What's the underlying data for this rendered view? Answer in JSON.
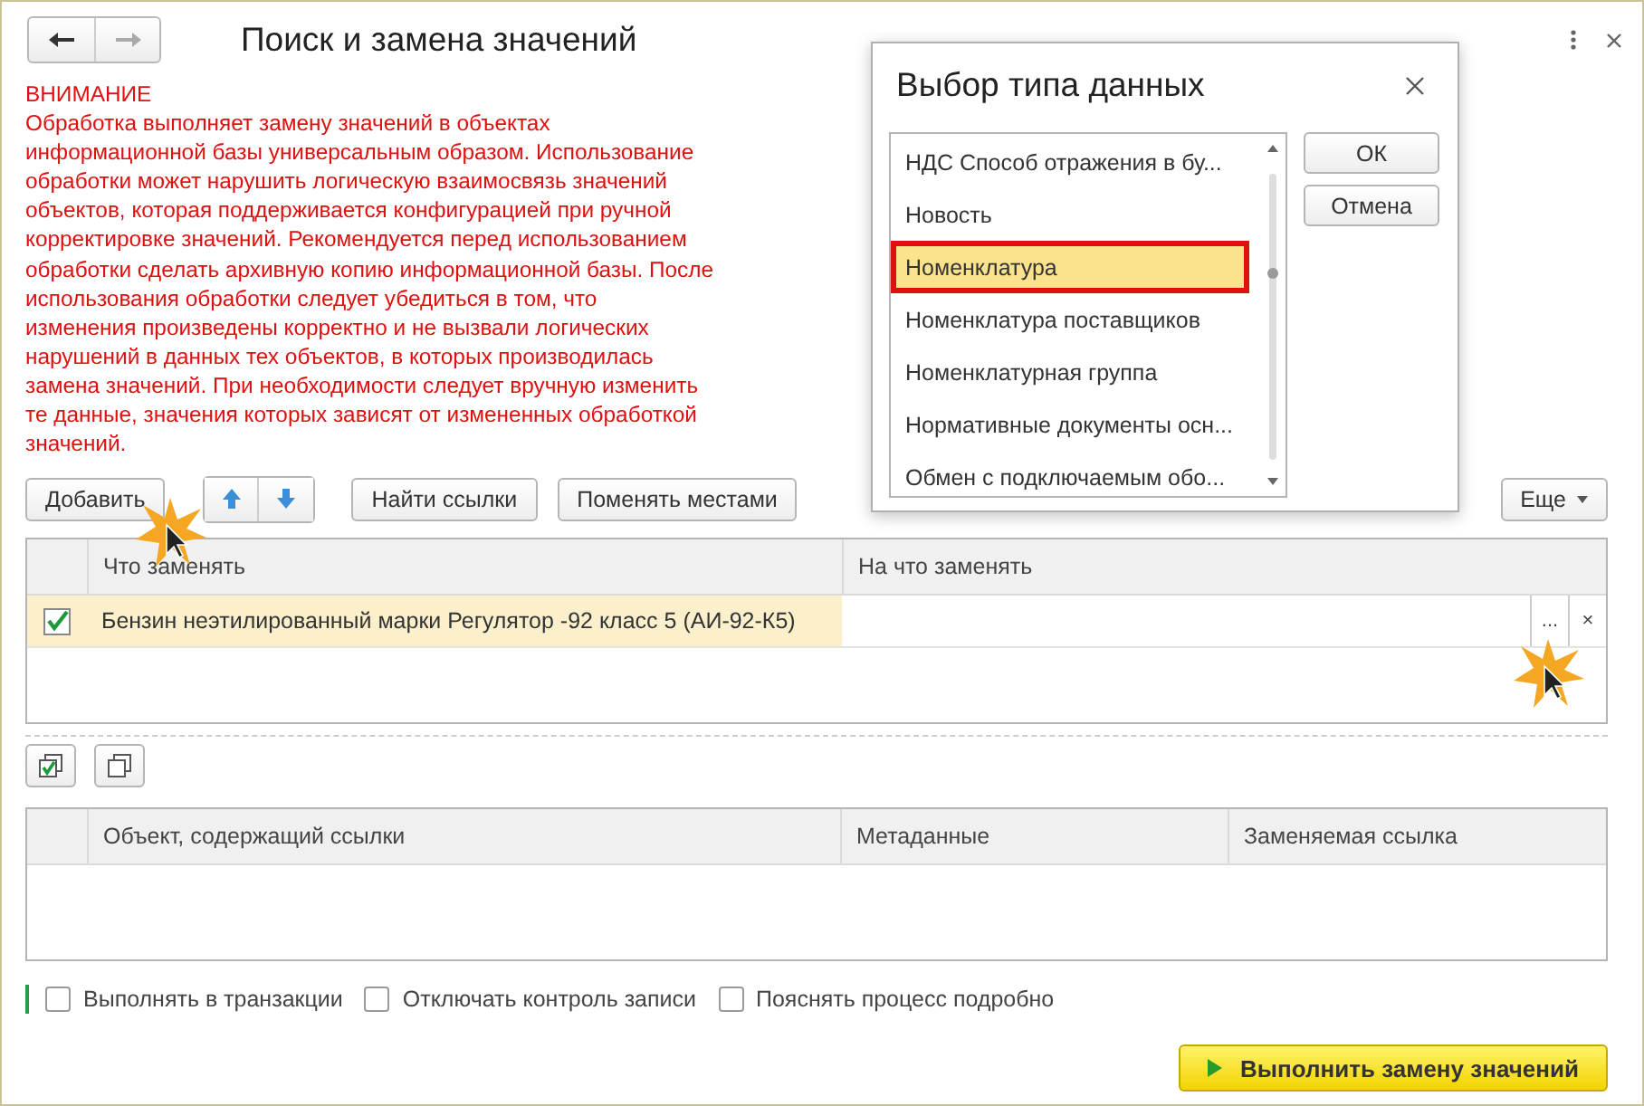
{
  "window": {
    "title": "Поиск и замена значений",
    "nav": [
      {
        "kind": "back",
        "disabled": false
      },
      {
        "kind": "forward",
        "disabled": true
      }
    ]
  },
  "warning": {
    "heading": "ВНИМАНИЕ",
    "body": "Обработка выполняет замену значений в объектах\nинформационной базы универсальным образом.  Использование\nобработки может нарушить логическую взаимосвязь значений\nобъектов, которая поддерживается конфигурацией при ручной\nкорректировке значений. Рекомендуется перед использованием\nобработки сделать архивную копию информационной базы. После\nиспользования обработки следует убедиться в том, что\nизменения произведены корректно и не вызвали логических\nнарушений в данных тех объектов, в которых производилась\nзамена значений. При необходимости следует вручную изменить\nте данные, значения которых зависят от измененных обработкой\nзначений."
  },
  "toolbar": {
    "add": "Добавить",
    "find": "Найти ссылки",
    "swap": "Поменять местами",
    "more": "Еще"
  },
  "replace_table": {
    "columns": [
      "Что заменять",
      "На что заменять"
    ],
    "rows": [
      {
        "checked": true,
        "what": "Бензин неэтилированный марки Регулятор -92 класс 5 (АИ-92-К5)",
        "selected": true,
        "choose": "...",
        "clear": "×"
      }
    ]
  },
  "refs_table": {
    "columns": [
      "Объект, содержащий ссылки",
      "Метаданные",
      "Заменяемая ссылка"
    ]
  },
  "options": [
    {
      "label": "Выполнять в транзакции",
      "checked": false
    },
    {
      "label": "Отключать контроль записи",
      "checked": false
    },
    {
      "label": "Пояснять процесс подробно",
      "checked": false
    }
  ],
  "run_button": "Выполнить замену значений",
  "dialog": {
    "title": "Выбор типа данных",
    "items": [
      {
        "label": "НДС Способ отражения в бу...",
        "selected": false
      },
      {
        "label": "Новость",
        "selected": false
      },
      {
        "label": "Номенклатура",
        "selected": true
      },
      {
        "label": "Номенклатура поставщиков",
        "selected": false
      },
      {
        "label": "Номенклатурная группа",
        "selected": false
      },
      {
        "label": "Нормативные документы осн...",
        "selected": false
      },
      {
        "label": "Обмен с подключаемым обо...",
        "selected": false
      }
    ],
    "buttons": [
      "ОК",
      "Отмена"
    ]
  }
}
